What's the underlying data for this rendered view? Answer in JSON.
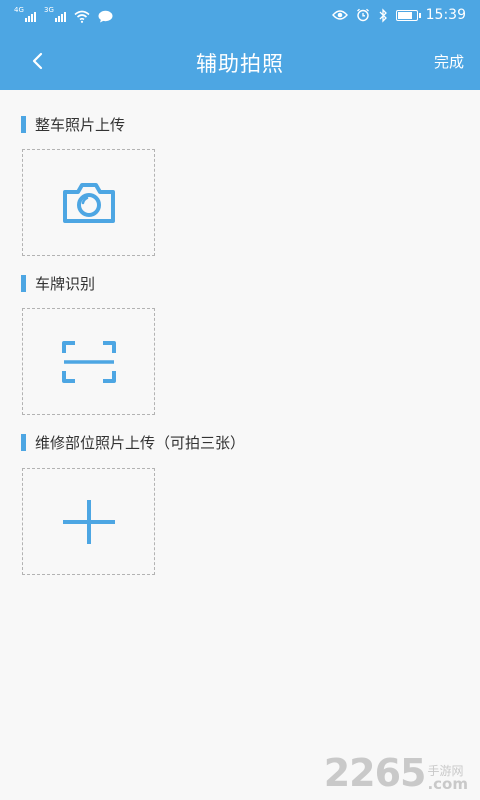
{
  "status_bar": {
    "sim1_net": "4G",
    "sim2_net": "3G",
    "time": "15:39",
    "battery_level": 0.85,
    "icons": [
      "wifi-icon",
      "message-icon",
      "eye-icon",
      "alarm-icon",
      "bluetooth-icon",
      "battery-icon"
    ]
  },
  "header": {
    "title": "辅助拍照",
    "done_label": "完成",
    "back_icon": "chevron-left-icon"
  },
  "sections": [
    {
      "title": "整车照片上传",
      "action_icon": "camera-icon"
    },
    {
      "title": "车牌识别",
      "action_icon": "scan-icon"
    },
    {
      "title": "维修部位照片上传（可拍三张）",
      "action_icon": "plus-icon"
    }
  ],
  "watermark": {
    "number": "2265",
    "cn_top": "手游网",
    "cn_bottom": ".com"
  },
  "colors": {
    "primary": "#4da6e3",
    "background": "#f8f8f8",
    "dash_border": "#b3b3b3",
    "text": "#333333"
  }
}
